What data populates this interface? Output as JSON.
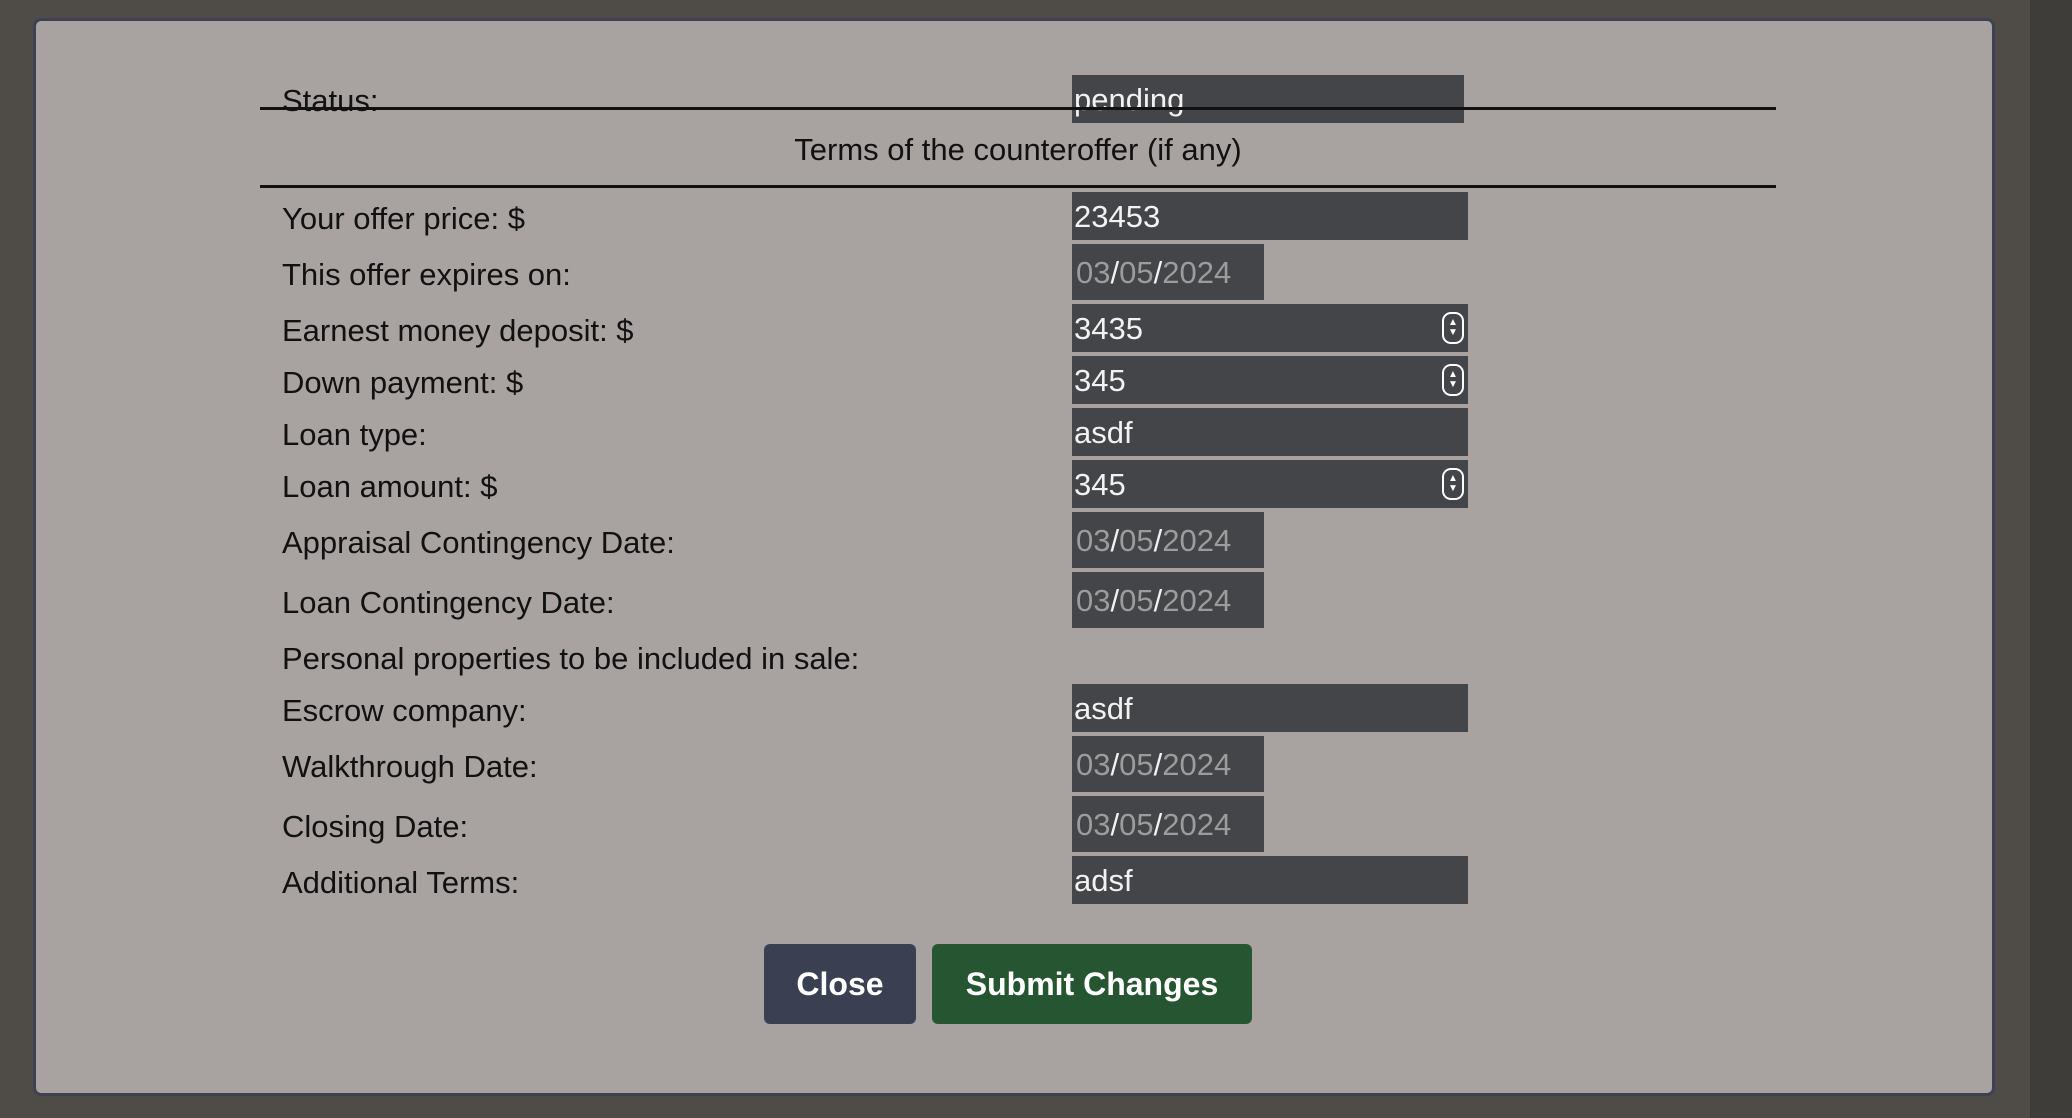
{
  "status": {
    "label": "Status:",
    "value": "pending"
  },
  "section_title": "Terms of the counteroffer (if any)",
  "fields": {
    "offer_price": {
      "label": "Your offer price: $",
      "value": "23453"
    },
    "expires_on": {
      "label": "This offer expires on:",
      "month": "03",
      "day": "05",
      "year": "2024"
    },
    "earnest_money": {
      "label": "Earnest money deposit: $",
      "value": "3435"
    },
    "down_payment": {
      "label": "Down payment: $",
      "value": "345"
    },
    "loan_type": {
      "label": "Loan type:",
      "value": "asdf"
    },
    "loan_amount": {
      "label": "Loan amount: $",
      "value": "345"
    },
    "appraisal_date": {
      "label": "Appraisal Contingency Date:",
      "month": "03",
      "day": "05",
      "year": "2024"
    },
    "loan_contingency_date": {
      "label": "Loan Contingency Date:",
      "month": "03",
      "day": "05",
      "year": "2024"
    },
    "personal_properties": {
      "label": "Personal properties to be included in sale:"
    },
    "escrow_company": {
      "label": "Escrow company:",
      "value": "asdf"
    },
    "walkthrough_date": {
      "label": "Walkthrough Date:",
      "month": "03",
      "day": "05",
      "year": "2024"
    },
    "closing_date": {
      "label": "Closing Date:",
      "month": "03",
      "day": "05",
      "year": "2024"
    },
    "additional_terms": {
      "label": "Additional Terms:",
      "value": "adsf"
    }
  },
  "buttons": {
    "close": "Close",
    "submit": "Submit Changes"
  },
  "colors": {
    "modal_bg": "#a8a3a0",
    "field_bg": "#444548",
    "close_btn": "#3a4052",
    "submit_btn": "#265631"
  }
}
